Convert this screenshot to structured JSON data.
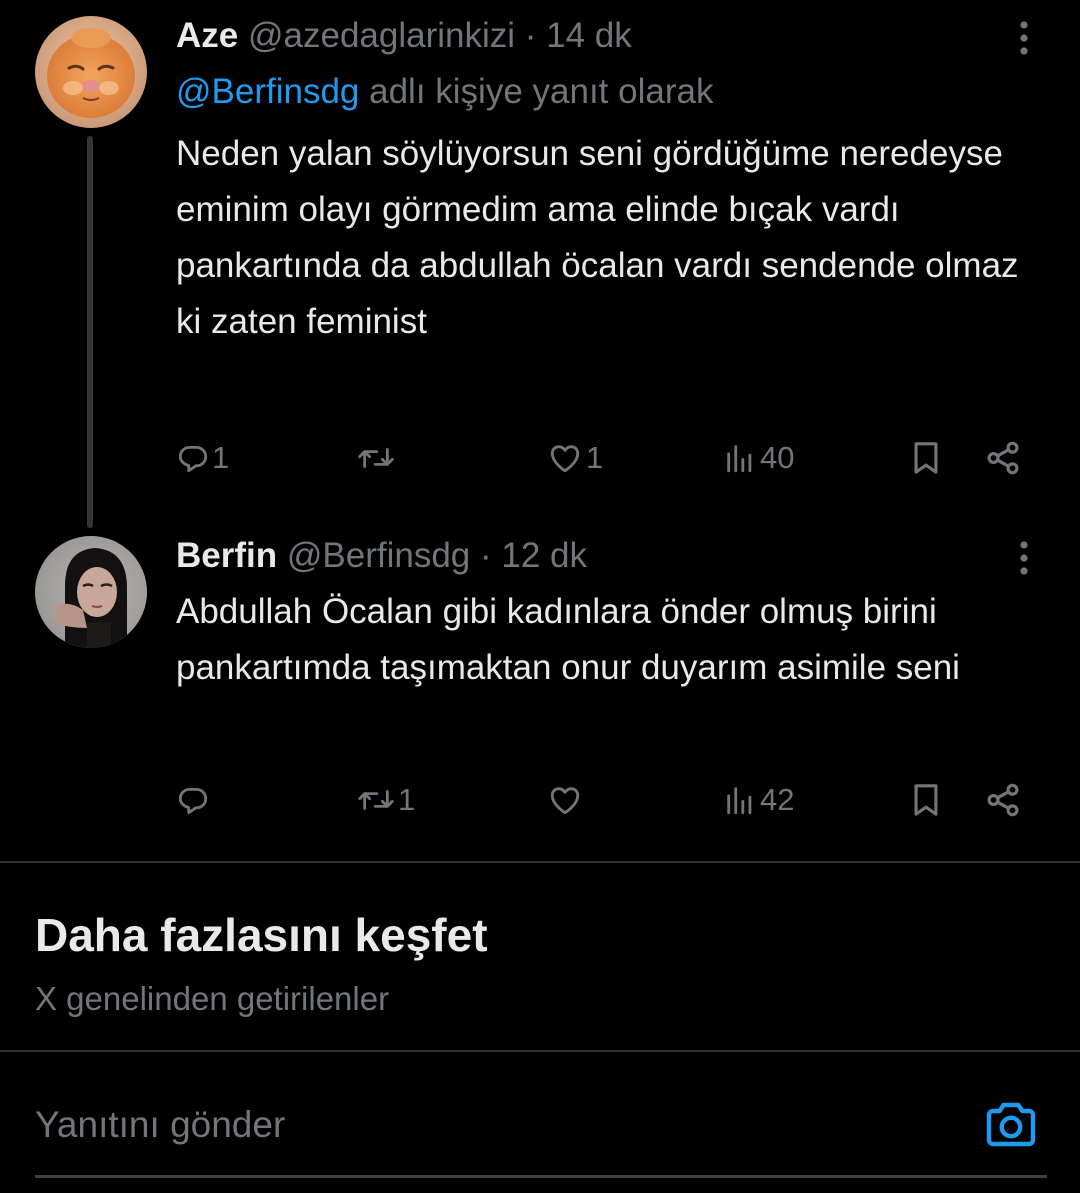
{
  "tweets": [
    {
      "display_name": "Aze",
      "handle": "@azedaglarinkizi",
      "separator": "·",
      "time": "14 dk",
      "reply_to_mention": "@Berfinsdg",
      "reply_to_suffix": " adlı kişiye yanıt olarak",
      "text": "Neden yalan söylüyorsun seni gördüğüme neredeyse eminim olayı görmedim ama elinde bıçak vardı pankartında da abdullah öcalan vardı sendende olmaz ki zaten feminist",
      "stats": {
        "replies": "1",
        "retweets": "",
        "likes": "1",
        "views": "40"
      }
    },
    {
      "display_name": "Berfin",
      "handle": "@Berfinsdg",
      "separator": "·",
      "time": "12 dk",
      "text": "Abdullah Öcalan gibi kadınlara önder olmuş birini pankartımda taşımaktan onur duyarım asimile seni",
      "stats": {
        "replies": "",
        "retweets": "1",
        "likes": "",
        "views": "42"
      }
    }
  ],
  "discover": {
    "title": "Daha fazlasını keşfet",
    "subtitle": "X genelinden getirilenler"
  },
  "composer": {
    "placeholder": "Yanıtını gönder"
  },
  "icons": {
    "reply": "reply-icon",
    "retweet": "retweet-icon",
    "like": "heart-icon",
    "views": "views-icon",
    "bookmark": "bookmark-icon",
    "share": "share-icon",
    "more": "more-icon",
    "camera": "camera-icon"
  },
  "colors": {
    "background": "#000000",
    "primary_text": "#e7e9ea",
    "secondary_text": "#71767b",
    "accent": "#1d9bf0",
    "divider": "#2f3336"
  }
}
